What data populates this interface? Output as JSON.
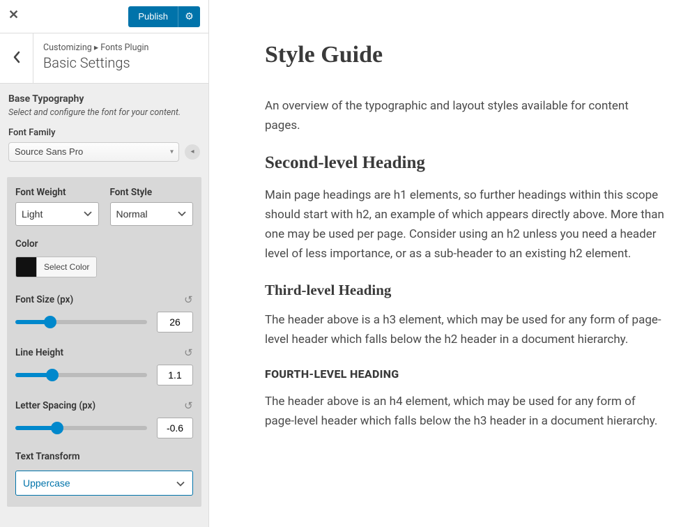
{
  "topbar": {
    "publish_label": "Publish"
  },
  "header": {
    "breadcrumb": "Customizing ▸ Fonts Plugin",
    "title": "Basic Settings"
  },
  "section": {
    "title": "Base Typography",
    "desc": "Select and configure the font for your content.",
    "font_family_label": "Font Family",
    "font_family_value": "Source Sans Pro"
  },
  "controls": {
    "font_weight_label": "Font Weight",
    "font_weight_value": "Light",
    "font_style_label": "Font Style",
    "font_style_value": "Normal",
    "color_label": "Color",
    "color_swatch": "#111111",
    "select_color_label": "Select Color",
    "font_size_label": "Font Size (px)",
    "font_size_value": "26",
    "line_height_label": "Line Height",
    "line_height_value": "1.1",
    "letter_spacing_label": "Letter Spacing (px)",
    "letter_spacing_value": "-0.6",
    "text_transform_label": "Text Transform",
    "text_transform_value": "Uppercase"
  },
  "preview": {
    "h1": "Style Guide",
    "p1": "An overview of the typographic and layout styles available for content pages.",
    "h2": "Second-level Heading",
    "p2": "Main page headings are h1 elements, so further headings within this scope should start with h2, an example of which appears directly above. More than one may be used per page. Consider using an h2 unless you need a header level of less importance, or as a sub-header to an existing h2 element.",
    "h3": "Third-level Heading",
    "p3": "The header above is a h3 element, which may be used for any form of page-level header which falls below the h2 header in a document hierarchy.",
    "h4": "Fourth-level Heading",
    "p4": "The header above is an h4 element, which may be used for any form of page-level header which falls below the h3 header in a document hierarchy."
  }
}
